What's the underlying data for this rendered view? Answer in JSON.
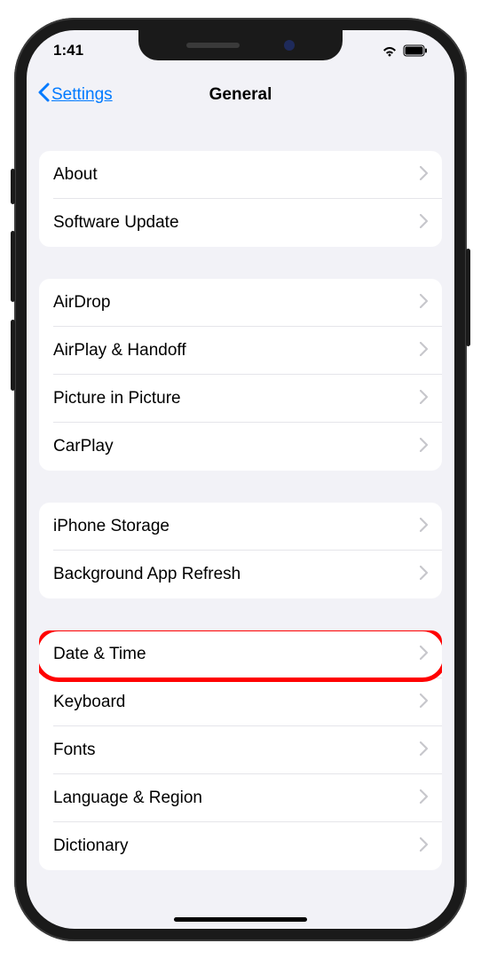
{
  "status": {
    "time": "1:41"
  },
  "nav": {
    "back": "Settings",
    "title": "General"
  },
  "groups": [
    {
      "items": [
        {
          "id": "about",
          "label": "About"
        },
        {
          "id": "software-update",
          "label": "Software Update"
        }
      ]
    },
    {
      "items": [
        {
          "id": "airdrop",
          "label": "AirDrop"
        },
        {
          "id": "airplay-handoff",
          "label": "AirPlay & Handoff"
        },
        {
          "id": "picture-in-picture",
          "label": "Picture in Picture"
        },
        {
          "id": "carplay",
          "label": "CarPlay"
        }
      ]
    },
    {
      "items": [
        {
          "id": "iphone-storage",
          "label": "iPhone Storage"
        },
        {
          "id": "background-app-refresh",
          "label": "Background App Refresh"
        }
      ]
    },
    {
      "items": [
        {
          "id": "date-time",
          "label": "Date & Time",
          "highlight": true
        },
        {
          "id": "keyboard",
          "label": "Keyboard"
        },
        {
          "id": "fonts",
          "label": "Fonts"
        },
        {
          "id": "language-region",
          "label": "Language & Region"
        },
        {
          "id": "dictionary",
          "label": "Dictionary"
        }
      ]
    }
  ],
  "highlight_color": "#ff0000"
}
